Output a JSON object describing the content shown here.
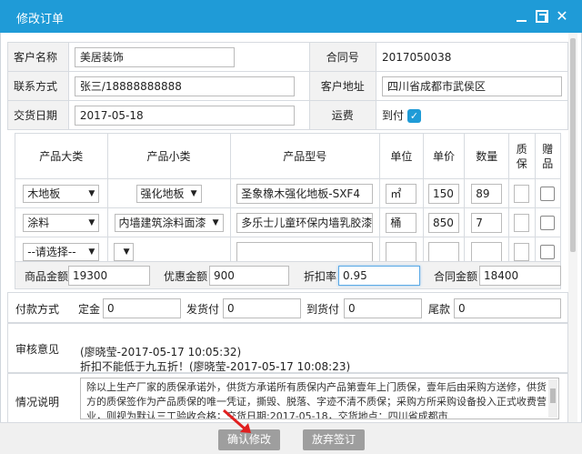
{
  "window": {
    "title": "修改订单"
  },
  "order": {
    "customer_name_label": "客户名称",
    "customer_name": "美居装饰",
    "contract_label": "合同号",
    "contract_no": "2017050038",
    "contact_label": "联系方式",
    "contact": "张三/18888888888",
    "address_label": "客户地址",
    "address": "四川省成都市武侯区",
    "delivery_label": "交货日期",
    "delivery_date": "2017-05-18",
    "freight_label": "运费",
    "freight_option": "到付",
    "freight_checked": true
  },
  "products": {
    "headers": [
      "产品大类",
      "产品小类",
      "产品型号",
      "单位",
      "单价",
      "数量",
      "质保",
      "赠品"
    ],
    "rows": [
      {
        "category": "木地板",
        "subcategory": "强化地板",
        "model": "圣象橡木强化地板-SXF4",
        "unit": "㎡",
        "price": "150",
        "qty": "89"
      },
      {
        "category": "涂料",
        "subcategory": "内墙建筑涂料面漆",
        "model": "多乐士儿童环保内墙乳胶漆",
        "unit": "桶",
        "price": "850",
        "qty": "7"
      },
      {
        "category": "--请选择--",
        "subcategory": "",
        "model": "",
        "unit": "",
        "price": "",
        "qty": ""
      }
    ]
  },
  "totals": {
    "goods_label": "商品金额",
    "goods": "19300",
    "discount_label": "优惠金额",
    "discount": "900",
    "rate_label": "折扣率",
    "rate": "0.95",
    "contract_label": "合同金额",
    "contract": "18400"
  },
  "payment": {
    "label": "付款方式",
    "deposit_label": "定金",
    "deposit": "0",
    "ship_label": "发货付",
    "ship": "0",
    "arrive_label": "到货付",
    "arrive": "0",
    "final_label": "尾款",
    "final": "0"
  },
  "review": {
    "label": "审核意见",
    "line1": "(廖晓莹-2017-05-17 10:05:32)",
    "line2": "折扣不能低于九五折！(廖晓莹-2017-05-17 10:08:23)"
  },
  "situation": {
    "label": "情况说明",
    "text": "除以上生产厂家的质保承诺外，供货方承诺所有质保内产品第壹年上门质保，壹年后由采购方送修，供货方的质保签作为产品质保的唯一凭证，撕毁、脱落、字迹不清不质保；采购方所采购设备投入正式收费营业，则视为默认三工验收合格；交货日期:2017-05-18，交货地点：四川省成都市"
  },
  "buttons": {
    "confirm": "确认修改",
    "abandon": "放弃签订"
  },
  "colors": {
    "titlebar": "#1f9bd7",
    "button": "#9e9e9e",
    "annotation_arrow": "#e02020"
  }
}
